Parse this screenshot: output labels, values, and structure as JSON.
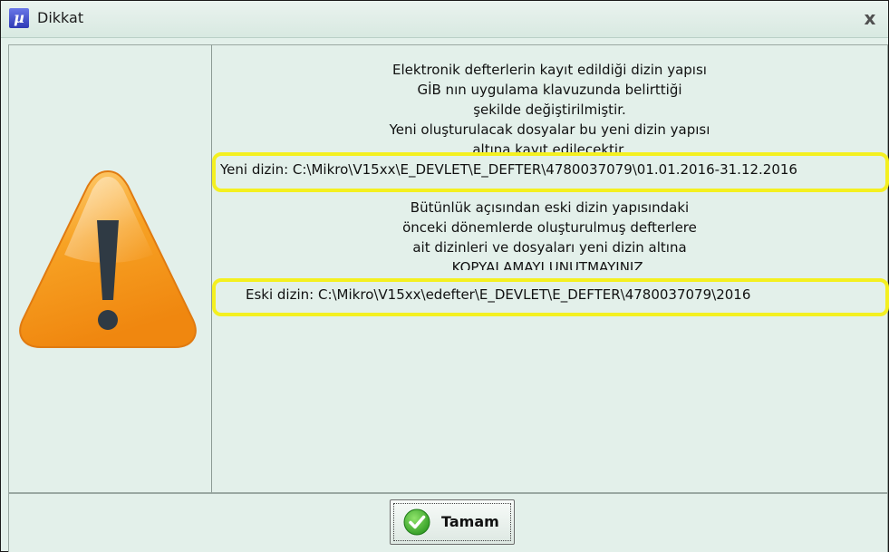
{
  "window": {
    "title": "Dikkat",
    "app_icon_glyph": "µ",
    "close_glyph": "x"
  },
  "message": {
    "paragraph1": [
      "Elektronik defterlerin kayıt edildiği dizin yapısı",
      "GİB nın uygulama klavuzunda belirttiği",
      "şekilde değiştirilmiştir.",
      "Yeni oluşturulacak dosyalar bu yeni dizin yapısı",
      "altına kayıt edilecektir."
    ],
    "new_path": "Yeni dizin: C:\\Mikro\\V15xx\\E_DEVLET\\E_DEFTER\\4780037079\\01.01.2016-31.12.2016",
    "paragraph2": [
      "Bütünlük açısından eski dizin yapısındaki",
      "önceki dönemlerde oluşturulmuş defterlere",
      "ait dizinleri ve dosyaları yeni dizin altına",
      "KOPYALAMAYI UNUTMAYINIZ."
    ],
    "old_path": "Eski dizin: C:\\Mikro\\V15xx\\edefter\\E_DEVLET\\E_DEFTER\\4780037079\\2016"
  },
  "buttons": {
    "ok_label": "Tamam"
  },
  "icons": {
    "warning": "warning-triangle-icon",
    "ok": "check-icon"
  },
  "colors": {
    "background": "#e3f0ea",
    "highlight": "#f4f020",
    "warning_orange": "#f59a1c",
    "check_green": "#3aa82a"
  }
}
